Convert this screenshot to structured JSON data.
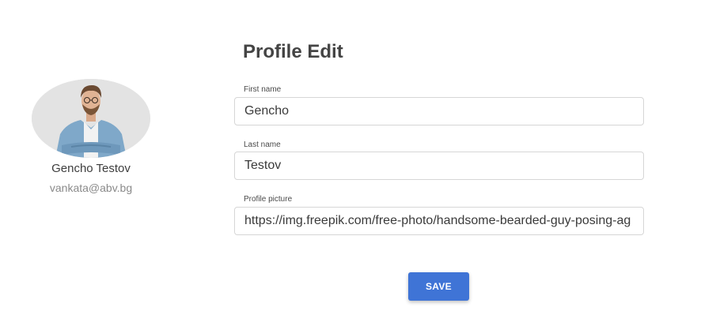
{
  "profile": {
    "name": "Gencho Testov",
    "email": "vankata@abv.bg",
    "avatar_icon": "avatar-photo"
  },
  "form": {
    "title": "Profile Edit",
    "first_name": {
      "label": "First name",
      "value": "Gencho"
    },
    "last_name": {
      "label": "Last name",
      "value": "Testov"
    },
    "profile_picture": {
      "label": "Profile picture",
      "value": "https://img.freepik.com/free-photo/handsome-bearded-guy-posing-ag"
    },
    "save_label": "SAVE"
  },
  "colors": {
    "accent": "#3f74d6",
    "avatar_bg": "#e3e3e3"
  }
}
